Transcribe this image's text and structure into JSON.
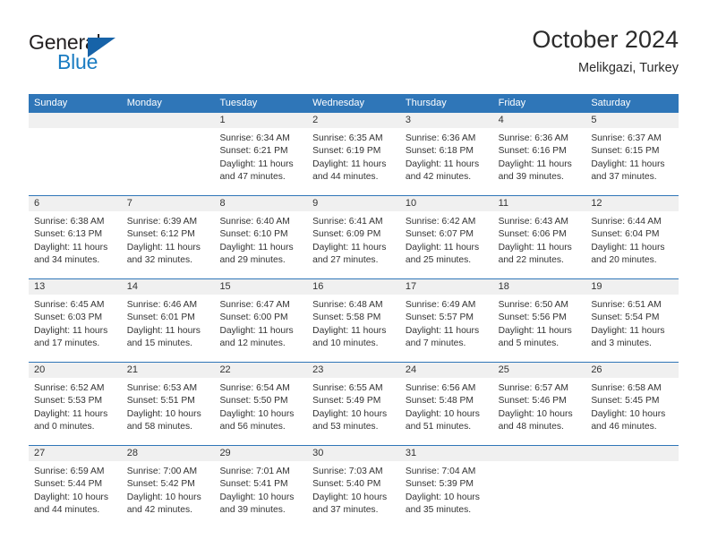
{
  "brand": {
    "name_top": "General",
    "name_bottom": "Blue",
    "accent_color": "#1763a8",
    "text_color": "#231f20"
  },
  "header": {
    "title": "October 2024",
    "subtitle": "Melikgazi, Turkey"
  },
  "theme": {
    "header_blue": "#2f76b8",
    "day_strip_gray": "#f0f0f0",
    "text": "#333333"
  },
  "weekdays": [
    "Sunday",
    "Monday",
    "Tuesday",
    "Wednesday",
    "Thursday",
    "Friday",
    "Saturday"
  ],
  "weeks": [
    [
      {
        "day": "",
        "lines": []
      },
      {
        "day": "",
        "lines": []
      },
      {
        "day": "1",
        "lines": [
          "Sunrise: 6:34 AM",
          "Sunset: 6:21 PM",
          "Daylight: 11 hours",
          "and 47 minutes."
        ]
      },
      {
        "day": "2",
        "lines": [
          "Sunrise: 6:35 AM",
          "Sunset: 6:19 PM",
          "Daylight: 11 hours",
          "and 44 minutes."
        ]
      },
      {
        "day": "3",
        "lines": [
          "Sunrise: 6:36 AM",
          "Sunset: 6:18 PM",
          "Daylight: 11 hours",
          "and 42 minutes."
        ]
      },
      {
        "day": "4",
        "lines": [
          "Sunrise: 6:36 AM",
          "Sunset: 6:16 PM",
          "Daylight: 11 hours",
          "and 39 minutes."
        ]
      },
      {
        "day": "5",
        "lines": [
          "Sunrise: 6:37 AM",
          "Sunset: 6:15 PM",
          "Daylight: 11 hours",
          "and 37 minutes."
        ]
      }
    ],
    [
      {
        "day": "6",
        "lines": [
          "Sunrise: 6:38 AM",
          "Sunset: 6:13 PM",
          "Daylight: 11 hours",
          "and 34 minutes."
        ]
      },
      {
        "day": "7",
        "lines": [
          "Sunrise: 6:39 AM",
          "Sunset: 6:12 PM",
          "Daylight: 11 hours",
          "and 32 minutes."
        ]
      },
      {
        "day": "8",
        "lines": [
          "Sunrise: 6:40 AM",
          "Sunset: 6:10 PM",
          "Daylight: 11 hours",
          "and 29 minutes."
        ]
      },
      {
        "day": "9",
        "lines": [
          "Sunrise: 6:41 AM",
          "Sunset: 6:09 PM",
          "Daylight: 11 hours",
          "and 27 minutes."
        ]
      },
      {
        "day": "10",
        "lines": [
          "Sunrise: 6:42 AM",
          "Sunset: 6:07 PM",
          "Daylight: 11 hours",
          "and 25 minutes."
        ]
      },
      {
        "day": "11",
        "lines": [
          "Sunrise: 6:43 AM",
          "Sunset: 6:06 PM",
          "Daylight: 11 hours",
          "and 22 minutes."
        ]
      },
      {
        "day": "12",
        "lines": [
          "Sunrise: 6:44 AM",
          "Sunset: 6:04 PM",
          "Daylight: 11 hours",
          "and 20 minutes."
        ]
      }
    ],
    [
      {
        "day": "13",
        "lines": [
          "Sunrise: 6:45 AM",
          "Sunset: 6:03 PM",
          "Daylight: 11 hours",
          "and 17 minutes."
        ]
      },
      {
        "day": "14",
        "lines": [
          "Sunrise: 6:46 AM",
          "Sunset: 6:01 PM",
          "Daylight: 11 hours",
          "and 15 minutes."
        ]
      },
      {
        "day": "15",
        "lines": [
          "Sunrise: 6:47 AM",
          "Sunset: 6:00 PM",
          "Daylight: 11 hours",
          "and 12 minutes."
        ]
      },
      {
        "day": "16",
        "lines": [
          "Sunrise: 6:48 AM",
          "Sunset: 5:58 PM",
          "Daylight: 11 hours",
          "and 10 minutes."
        ]
      },
      {
        "day": "17",
        "lines": [
          "Sunrise: 6:49 AM",
          "Sunset: 5:57 PM",
          "Daylight: 11 hours",
          "and 7 minutes."
        ]
      },
      {
        "day": "18",
        "lines": [
          "Sunrise: 6:50 AM",
          "Sunset: 5:56 PM",
          "Daylight: 11 hours",
          "and 5 minutes."
        ]
      },
      {
        "day": "19",
        "lines": [
          "Sunrise: 6:51 AM",
          "Sunset: 5:54 PM",
          "Daylight: 11 hours",
          "and 3 minutes."
        ]
      }
    ],
    [
      {
        "day": "20",
        "lines": [
          "Sunrise: 6:52 AM",
          "Sunset: 5:53 PM",
          "Daylight: 11 hours",
          "and 0 minutes."
        ]
      },
      {
        "day": "21",
        "lines": [
          "Sunrise: 6:53 AM",
          "Sunset: 5:51 PM",
          "Daylight: 10 hours",
          "and 58 minutes."
        ]
      },
      {
        "day": "22",
        "lines": [
          "Sunrise: 6:54 AM",
          "Sunset: 5:50 PM",
          "Daylight: 10 hours",
          "and 56 minutes."
        ]
      },
      {
        "day": "23",
        "lines": [
          "Sunrise: 6:55 AM",
          "Sunset: 5:49 PM",
          "Daylight: 10 hours",
          "and 53 minutes."
        ]
      },
      {
        "day": "24",
        "lines": [
          "Sunrise: 6:56 AM",
          "Sunset: 5:48 PM",
          "Daylight: 10 hours",
          "and 51 minutes."
        ]
      },
      {
        "day": "25",
        "lines": [
          "Sunrise: 6:57 AM",
          "Sunset: 5:46 PM",
          "Daylight: 10 hours",
          "and 48 minutes."
        ]
      },
      {
        "day": "26",
        "lines": [
          "Sunrise: 6:58 AM",
          "Sunset: 5:45 PM",
          "Daylight: 10 hours",
          "and 46 minutes."
        ]
      }
    ],
    [
      {
        "day": "27",
        "lines": [
          "Sunrise: 6:59 AM",
          "Sunset: 5:44 PM",
          "Daylight: 10 hours",
          "and 44 minutes."
        ]
      },
      {
        "day": "28",
        "lines": [
          "Sunrise: 7:00 AM",
          "Sunset: 5:42 PM",
          "Daylight: 10 hours",
          "and 42 minutes."
        ]
      },
      {
        "day": "29",
        "lines": [
          "Sunrise: 7:01 AM",
          "Sunset: 5:41 PM",
          "Daylight: 10 hours",
          "and 39 minutes."
        ]
      },
      {
        "day": "30",
        "lines": [
          "Sunrise: 7:03 AM",
          "Sunset: 5:40 PM",
          "Daylight: 10 hours",
          "and 37 minutes."
        ]
      },
      {
        "day": "31",
        "lines": [
          "Sunrise: 7:04 AM",
          "Sunset: 5:39 PM",
          "Daylight: 10 hours",
          "and 35 minutes."
        ]
      },
      {
        "day": "",
        "lines": []
      },
      {
        "day": "",
        "lines": []
      }
    ]
  ]
}
